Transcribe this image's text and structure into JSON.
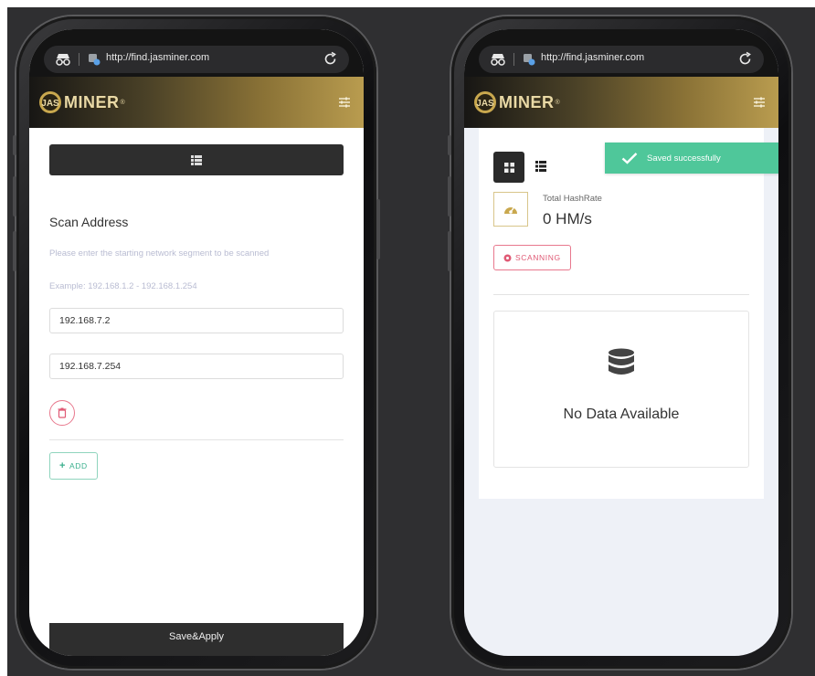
{
  "browser": {
    "url": "http://find.jasminer.com"
  },
  "brand": {
    "logo_text": "MINER",
    "logo_mark": "JAS",
    "registered": "®",
    "colors": {
      "gold": "#b99c4f",
      "dark": "#171614",
      "success": "#4fc79a",
      "danger": "#e05a75",
      "add": "#3bb08e"
    }
  },
  "icons": {
    "incognito": "incognito-icon",
    "site": "site-icon",
    "reload": "reload-icon",
    "settings": "settings-icon",
    "list": "list-icon",
    "grid": "grid-icon",
    "gauge": "gauge-icon",
    "delete": "trash-icon",
    "plus": "plus-icon",
    "radar": "radar-icon",
    "database": "database-icon",
    "check": "check-icon"
  },
  "scan_screen": {
    "title": "Scan Address",
    "instruction": "Please enter the starting network segment to be scanned",
    "example": "Example: 192.168.1.2 - 192.168.1.254",
    "start_ip": "192.168.7.2",
    "end_ip": "192.168.7.254",
    "add_label": "ADD",
    "add_prefix": "+",
    "save_label": "Save&Apply"
  },
  "dashboard_screen": {
    "total_hashrate_label": "Total HashRate",
    "total_hashrate_value": "0 HM/s",
    "scanning_label": "SCANNING",
    "empty_text": "No Data Available",
    "toast_text": "Saved successfully"
  }
}
